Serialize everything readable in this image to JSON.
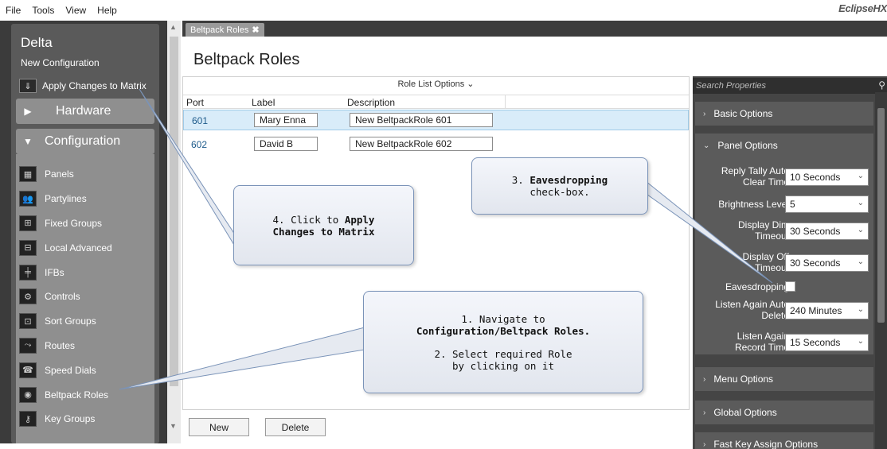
{
  "menubar": {
    "items": [
      "File",
      "Tools",
      "View",
      "Help"
    ],
    "brand": "EclipseHX"
  },
  "leftnav": {
    "title": "Delta",
    "subtitle": "New Configuration",
    "apply_label": "Apply Changes to Matrix",
    "hardware_label": "Hardware",
    "configuration_label": "Configuration",
    "items": [
      "Panels",
      "Partylines",
      "Fixed Groups",
      "Local Advanced",
      "IFBs",
      "Controls",
      "Sort Groups",
      "Routes",
      "Speed Dials",
      "Beltpack Roles",
      "Key Groups"
    ]
  },
  "tab": {
    "label": "Beltpack Roles",
    "close": "✖"
  },
  "page_title": "Beltpack Roles",
  "table": {
    "options_label": "Role List Options ⌄",
    "headers": {
      "port": "Port",
      "label": "Label",
      "description": "Description"
    },
    "rows": [
      {
        "port": "601",
        "label": "Mary Enna",
        "description": "New BeltpackRole 601",
        "selected": true
      },
      {
        "port": "602",
        "label": "David B",
        "description": "New BeltpackRole 602",
        "selected": false
      }
    ]
  },
  "buttons": {
    "new": "New",
    "delete": "Delete"
  },
  "properties": {
    "search_placeholder": "Search Properties",
    "sections": {
      "basic": "Basic Options",
      "panel": "Panel Options",
      "menu": "Menu Options",
      "global": "Global Options",
      "fast_key": "Fast Key Assign Options"
    },
    "fields": {
      "reply_tally": {
        "label": "Reply Tally Auto Clear Time",
        "value": "10 Seconds"
      },
      "brightness": {
        "label": "Brightness Level",
        "value": "5"
      },
      "display_dim": {
        "label": "Display Dim Timeout",
        "value": "30 Seconds"
      },
      "display_off": {
        "label": "Display Off Timeout",
        "value": "30 Seconds"
      },
      "eavesdropping": {
        "label": "Eavesdropping",
        "checked": false
      },
      "listen_again_delete": {
        "label": "Listen Again Auto Delete",
        "value": "240 Minutes"
      },
      "listen_again_record": {
        "label": "Listen Again Record Time",
        "value": "15 Seconds"
      }
    }
  },
  "callouts": {
    "c1_line1": "1. Navigate to",
    "c1_line2": "Configuration/Beltpack Roles.",
    "c2_line1": "2. Select required Role",
    "c2_line2": "by clicking on it",
    "c3_line1_prefix": "3. ",
    "c3_line1_bold": "Eavesdropping",
    "c3_line2": "check-box.",
    "c4_line1_prefix": "4. Click to ",
    "c4_line1_bold": "Apply",
    "c4_line2": "Changes to Matrix"
  }
}
